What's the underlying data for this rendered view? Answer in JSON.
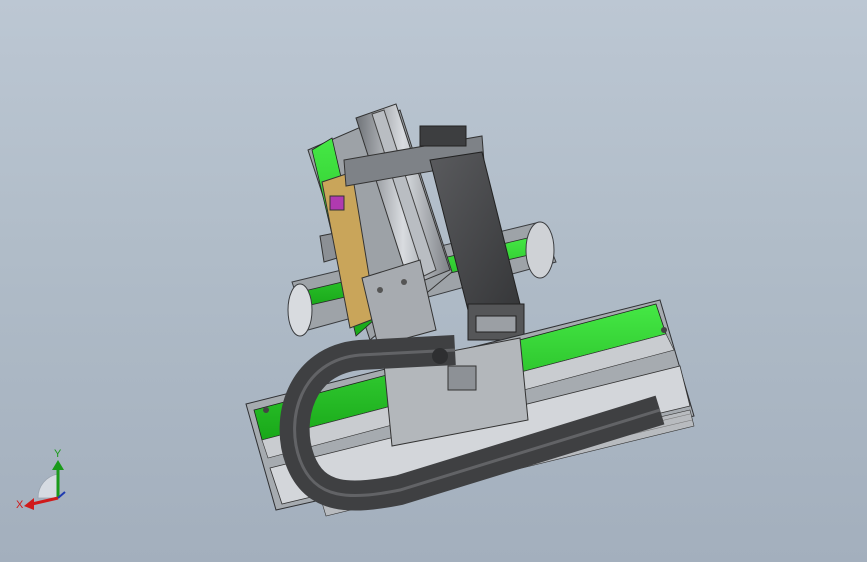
{
  "viewport": {
    "background_top": "#bcc7d3",
    "background_bottom": "#a3afbd"
  },
  "model": {
    "accent_green": "#2fd42f",
    "frame_gray": "#8a8d91",
    "cable_chain": "#4a4a4c"
  },
  "triad": {
    "x_label": "X",
    "y_label": "Y",
    "x_color": "#d01a1a",
    "y_color": "#1a9a1a"
  }
}
